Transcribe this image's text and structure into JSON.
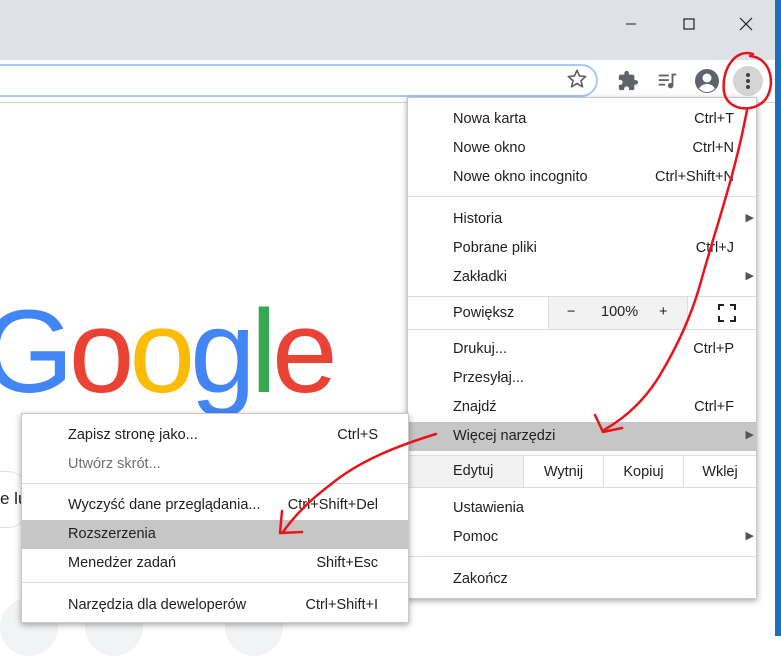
{
  "window": {
    "minimize_icon": "minimize-icon",
    "maximize_icon": "maximize-icon",
    "close_icon": "close-icon"
  },
  "toolbar": {
    "icons": [
      "star-icon",
      "puzzle-extensions-icon",
      "media-playlist-icon",
      "profile-avatar-icon",
      "three-dots-menu-icon"
    ]
  },
  "page": {
    "logo_text": [
      "G",
      "o",
      "o",
      "g",
      "l",
      "e"
    ],
    "search_fragment": "e lu"
  },
  "main_menu": {
    "group1": [
      {
        "label": "Nowa karta",
        "shortcut": "Ctrl+T"
      },
      {
        "label": "Nowe okno",
        "shortcut": "Ctrl+N"
      },
      {
        "label": "Nowe okno incognito",
        "shortcut": "Ctrl+Shift+N"
      }
    ],
    "group2": [
      {
        "label": "Historia",
        "shortcut": ""
      },
      {
        "label": "Pobrane pliki",
        "shortcut": "Ctrl+J"
      },
      {
        "label": "Zakładki",
        "shortcut": ""
      }
    ],
    "zoom": {
      "label": "Powiększ",
      "minus": "−",
      "value": "100%",
      "plus": "+"
    },
    "group3": [
      {
        "label": "Drukuj...",
        "shortcut": "Ctrl+P"
      },
      {
        "label": "Przesyłaj...",
        "shortcut": ""
      },
      {
        "label": "Znajdź",
        "shortcut": "Ctrl+F"
      },
      {
        "label": "Więcej narzędzi",
        "shortcut": ""
      }
    ],
    "edit": {
      "label": "Edytuj",
      "cut": "Wytnij",
      "copy": "Kopiuj",
      "paste": "Wklej"
    },
    "group4": [
      {
        "label": "Ustawienia",
        "shortcut": ""
      },
      {
        "label": "Pomoc",
        "shortcut": ""
      }
    ],
    "exit": {
      "label": "Zakończ"
    }
  },
  "sub_menu": {
    "group1": [
      {
        "label": "Zapisz stronę jako...",
        "shortcut": "Ctrl+S"
      },
      {
        "label": "Utwórz skrót...",
        "shortcut": ""
      }
    ],
    "group2": [
      {
        "label": "Wyczyść dane przeglądania...",
        "shortcut": "Ctrl+Shift+Del"
      },
      {
        "label": "Rozszerzenia",
        "shortcut": ""
      },
      {
        "label": "Menedżer zadań",
        "shortcut": "Shift+Esc"
      }
    ],
    "group3": [
      {
        "label": "Narzędzia dla deweloperów",
        "shortcut": "Ctrl+Shift+I"
      }
    ]
  },
  "colors": {
    "annotation": "#e8141c",
    "highlight": "#c6c6c6",
    "titlebar": "#dee1e6"
  }
}
